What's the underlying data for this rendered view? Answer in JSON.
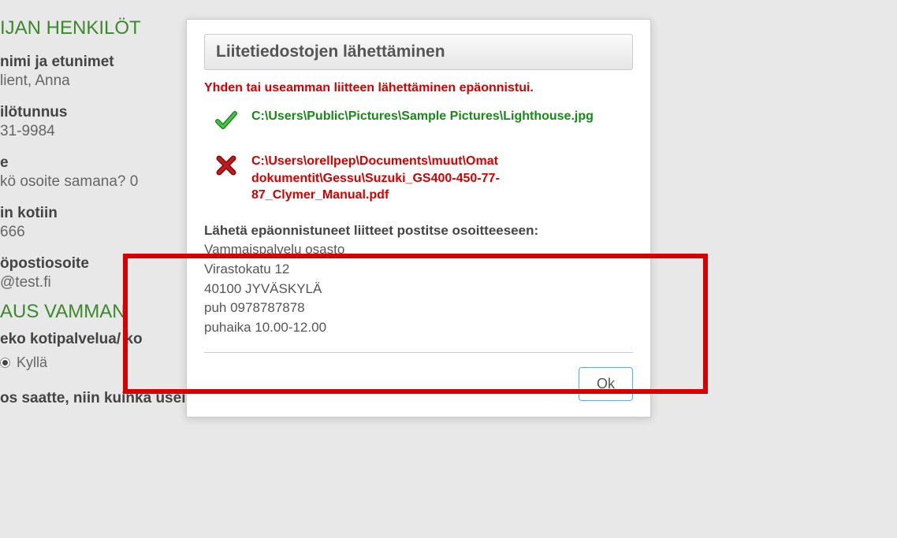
{
  "background": {
    "section1_header": "IJAN HENKILÖT",
    "name_label": "nimi ja etunimet",
    "name_value": "lient, Anna",
    "ssn_label": "ilötunnus",
    "ssn_value": "31-9984",
    "address_label": "e",
    "address_value": "kö osoite samana? 0",
    "home_label": "in kotiin",
    "home_value": "666",
    "email_label": "öpostiosoite",
    "email_value": "@test.fi",
    "section2_header": "AUS VAMMAN",
    "q1": "eko kotipalvelua/ ko",
    "radio_kylla": "Kyllä",
    "q2": "os saatte, niin kuinka usein?"
  },
  "modal": {
    "title": "Liitetiedostojen lähettäminen",
    "error_summary": "Yhden tai useamman liitteen lähettäminen epäonnistui.",
    "file_success": "C:\\Users\\Public\\Pictures\\Sample Pictures\\Lighthouse.jpg",
    "file_error": "C:\\Users\\orellpep\\Documents\\muut\\Omat dokumentit\\Gessu\\Suzuki_GS400-450-77-87_Clymer_Manual.pdf",
    "address_heading": "Lähetä epäonnistuneet liitteet postitse osoitteeseen:",
    "address_line1": "Vammaispalvelu osasto",
    "address_line2": "Virastokatu 12",
    "address_line3": "40100 JYVÄSKYLÄ",
    "address_line4": "puh 0978787878",
    "address_line5": "puhaika 10.00-12.00",
    "ok_label": "Ok"
  }
}
